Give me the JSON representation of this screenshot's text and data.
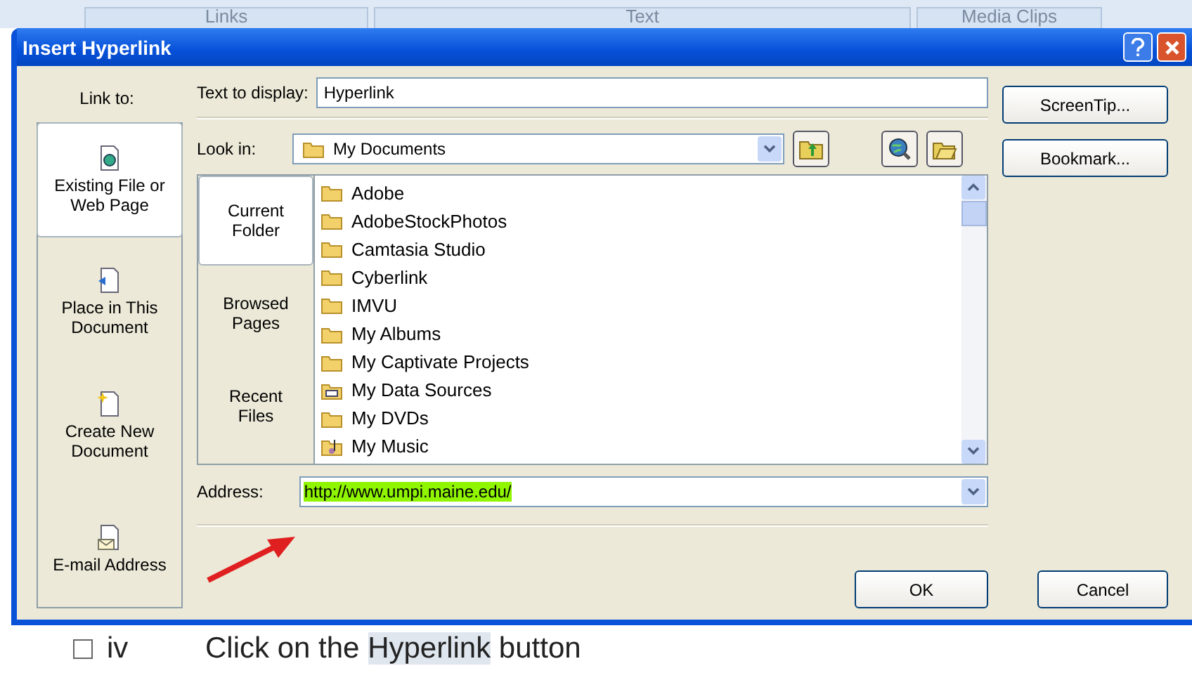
{
  "ribbon_tabs": [
    "Links",
    "Text",
    "Media Clips"
  ],
  "window": {
    "title": "Insert Hyperlink"
  },
  "link_to": {
    "label": "Link to:",
    "items": [
      {
        "label": "Existing File or Web Page",
        "kind": "file",
        "selected": true
      },
      {
        "label": "Place in This Document",
        "kind": "place",
        "selected": false
      },
      {
        "label": "Create New Document",
        "kind": "new",
        "selected": false
      },
      {
        "label": "E-mail Address",
        "kind": "mail",
        "selected": false
      }
    ]
  },
  "text_to_display": {
    "label": "Text to display:",
    "value": "Hyperlink"
  },
  "look_in": {
    "label": "Look in:",
    "value": "My Documents"
  },
  "places": [
    {
      "label": "Current Folder",
      "selected": true
    },
    {
      "label": "Browsed Pages",
      "selected": false
    },
    {
      "label": "Recent Files",
      "selected": false
    }
  ],
  "files": [
    {
      "name": "Adobe",
      "kind": "folder"
    },
    {
      "name": "AdobeStockPhotos",
      "kind": "folder"
    },
    {
      "name": "Camtasia Studio",
      "kind": "folder"
    },
    {
      "name": "Cyberlink",
      "kind": "folder"
    },
    {
      "name": "IMVU",
      "kind": "folder"
    },
    {
      "name": "My Albums",
      "kind": "folder"
    },
    {
      "name": "My Captivate Projects",
      "kind": "folder"
    },
    {
      "name": "My Data Sources",
      "kind": "datasource"
    },
    {
      "name": "My DVDs",
      "kind": "folder"
    },
    {
      "name": "My Music",
      "kind": "music"
    }
  ],
  "address": {
    "label": "Address:",
    "value": "http://www.umpi.maine.edu/",
    "highlighted": true
  },
  "side_buttons": [
    "ScreenTip...",
    "Bookmark..."
  ],
  "buttons": [
    "OK",
    "Cancel"
  ],
  "document_line": {
    "number": "iv",
    "parts": [
      {
        "text": "Click on the ",
        "highlighted": false
      },
      {
        "text": "Hyperlink",
        "highlighted": true
      },
      {
        "text": " button",
        "highlighted": false
      }
    ]
  }
}
